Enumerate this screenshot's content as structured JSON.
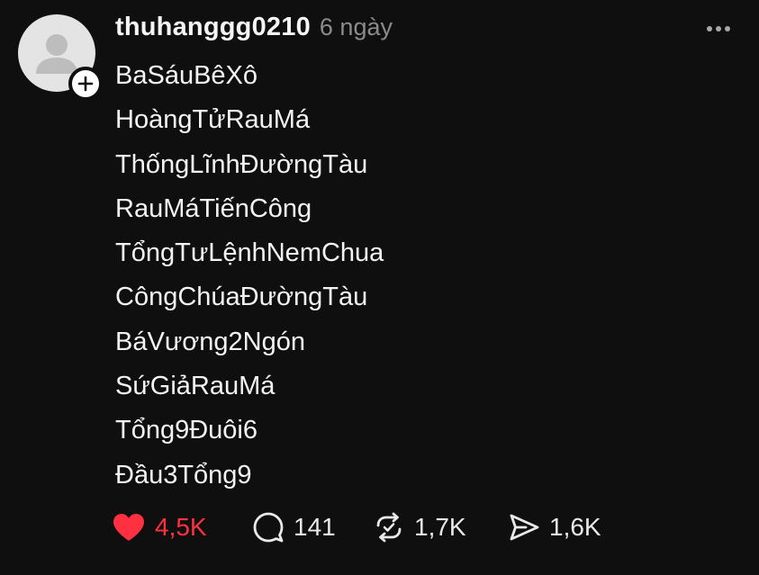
{
  "post": {
    "username": "thuhanggg0210",
    "time": "6 ngày",
    "lines": [
      "BaSáuBêXô",
      "HoàngTửRauMá",
      "ThốngLĩnhĐườngTàu",
      "RauMáTiếnCông",
      "TổngTưLệnhNemChua",
      "CôngChúaĐườngTàu",
      "BáVương2Ngón",
      "SứGiảRauMá",
      "Tổng9Đuôi6",
      "Đầu3Tổng9"
    ]
  },
  "actions": {
    "likes": "4,5K",
    "comments": "141",
    "reposts": "1,7K",
    "shares": "1,6K"
  },
  "colors": {
    "background": "#0f0f0f",
    "like_red": "#ff3040",
    "muted": "#8b8b8b",
    "text": "#f3f3f3"
  },
  "icons": [
    "avatar-placeholder-icon",
    "plus-icon",
    "more-icon",
    "heart-icon",
    "comment-icon",
    "repost-icon",
    "share-icon"
  ]
}
